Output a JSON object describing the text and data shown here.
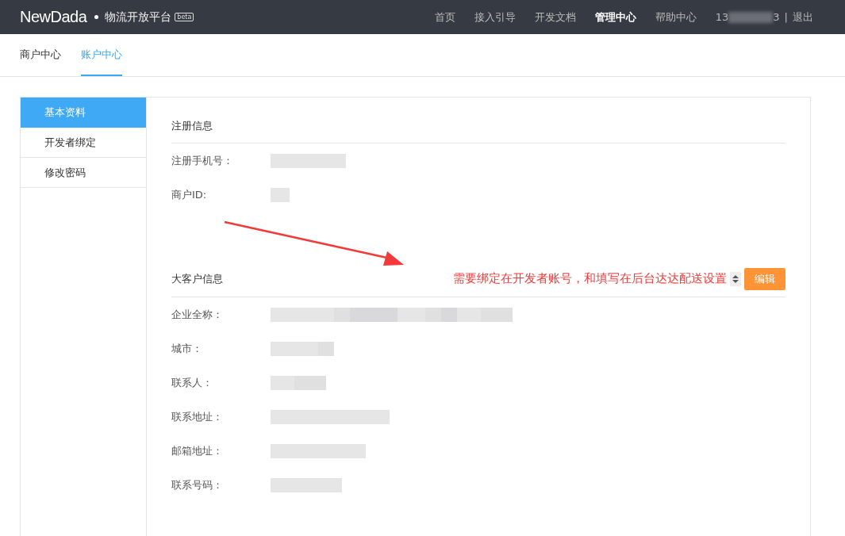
{
  "header": {
    "logo": "NewDada",
    "platform": "物流开放平台",
    "beta": "beta",
    "nav": [
      {
        "label": "首页",
        "selected": false
      },
      {
        "label": "接入引导",
        "selected": false
      },
      {
        "label": "开发文档",
        "selected": false
      },
      {
        "label": "管理中心",
        "selected": true
      },
      {
        "label": "帮助中心",
        "selected": false
      }
    ],
    "user_start": "13",
    "user_end": "3",
    "separator": "|",
    "logout": "退出"
  },
  "subtabs": [
    {
      "label": "商户中心",
      "selected": false
    },
    {
      "label": "账户中心",
      "selected": true
    }
  ],
  "sidebar": {
    "items": [
      {
        "label": "基本资料",
        "selected": true
      },
      {
        "label": "开发者绑定",
        "selected": false
      },
      {
        "label": "修改密码",
        "selected": false
      }
    ]
  },
  "sections": [
    {
      "title": "注册信息",
      "fields": [
        {
          "label": "注册手机号："
        },
        {
          "label": "商户ID:"
        }
      ]
    },
    {
      "title": "大客户信息",
      "edit_button": "编辑",
      "fields": [
        {
          "label": "企业全称："
        },
        {
          "label": "城市："
        },
        {
          "label": "联系人："
        },
        {
          "label": "联系地址："
        },
        {
          "label": "邮箱地址："
        },
        {
          "label": "联系号码："
        }
      ]
    }
  ],
  "annotation": {
    "text": "需要绑定在开发者账号，和填写在后台达达配送设置"
  }
}
